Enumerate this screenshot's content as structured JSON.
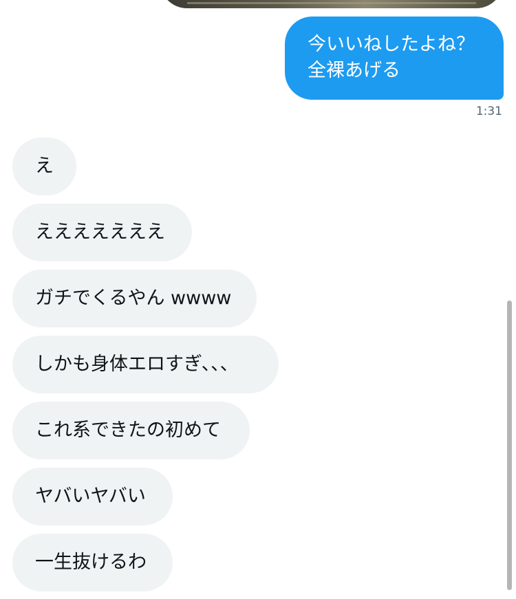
{
  "sent_message": {
    "lines": [
      "今いいねしたよね？",
      "全裸あげる"
    ],
    "time": "1:31",
    "bubble_color": "#1d9bf0"
  },
  "received_messages": [
    "え",
    "えええええええ",
    "ガチでくるやん wwww",
    "しかも身体エロすぎ、、、",
    "これ系できたの初めて",
    "ヤバいヤバい",
    "一生抜けるわ"
  ],
  "colors": {
    "received_bubble": "#eff3f4",
    "timestamp_text": "#536471"
  }
}
